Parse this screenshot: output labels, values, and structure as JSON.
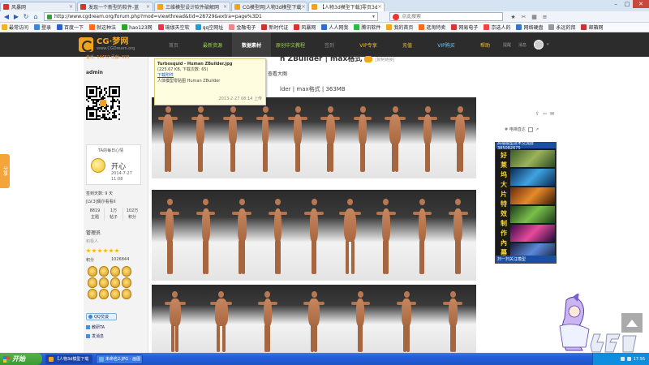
{
  "browser": {
    "tabs": [
      {
        "label": "风暴网",
        "color": "#d6332a",
        "active": false
      },
      {
        "label": "发现一个新型的软件-蓝",
        "color": "#d6332a",
        "active": false
      },
      {
        "label": "三维模型设计软件破解网",
        "color": "#f0a31c",
        "active": false
      },
      {
        "label": "CG模型网|人物3d模型下载",
        "color": "#f0a31c",
        "active": false
      },
      {
        "label": "【人物3d模型下载]零页3d",
        "color": "#f0a31c",
        "active": true
      }
    ],
    "address": "http://www.cgdream.org/forum.php?mod=viewthread&tid=28729&extra=page%3D1",
    "search_placeholder": "点此搜索"
  },
  "bookmarks": [
    {
      "label": "最常访问",
      "color": "#f0b429"
    },
    {
      "label": "登录",
      "color": "#3e87d8"
    },
    {
      "label": "百度一下",
      "color": "#2e5fd1"
    },
    {
      "label": "就这种法",
      "color": "#ff6b1a"
    },
    {
      "label": "hao123网",
      "color": "#2aa52a"
    },
    {
      "label": "瑜伽天空软",
      "color": "#e34"
    },
    {
      "label": "qq空网址",
      "color": "#1b9dd9"
    },
    {
      "label": "金融电子",
      "color": "#e88"
    },
    {
      "label": "新时代证",
      "color": "#c33"
    },
    {
      "label": "风暴网",
      "color": "#d6332a"
    },
    {
      "label": "人人网我",
      "color": "#2d6fd1"
    },
    {
      "label": "腾讯软件",
      "color": "#2db84a"
    },
    {
      "label": "我的首页",
      "color": "#f4a81c"
    },
    {
      "label": "逛淘特卖",
      "color": "#f36b1c"
    },
    {
      "label": "网易电子",
      "color": "#d33"
    },
    {
      "label": "京选人的",
      "color": "#e44"
    },
    {
      "label": "网络硬盘",
      "color": "#3377cc"
    },
    {
      "label": "永远的拜",
      "color": "#999"
    },
    {
      "label": "邮箱网",
      "color": "#c33"
    }
  ],
  "site": {
    "logo_name": "CG·梦网",
    "logo_sub": "www.CGDream.org",
    "nav": [
      {
        "label": "首页",
        "style": "dim"
      },
      {
        "label": "最新资源",
        "style": "hl"
      },
      {
        "label": "数据素材",
        "style": "cur"
      },
      {
        "label": "原创中文教程",
        "style": "hl"
      },
      {
        "label": "签到",
        "style": "dim"
      },
      {
        "label": "VIP专享",
        "style": "yl"
      },
      {
        "label": "充值",
        "style": "yl"
      },
      {
        "label": "VIP购买",
        "style": "bl"
      },
      {
        "label": "帮助",
        "style": "yl"
      }
    ],
    "user_links": [
      "提醒",
      "消息"
    ]
  },
  "sidebar": {
    "stats_line": "金币: 14452  贡献: 693",
    "username": "admin",
    "mood_label": "TA的每日心情",
    "mood": "开心",
    "mood_date": "2014-7-27 11:08",
    "signin_days": "签到天数: 9 天",
    "level": "[LV.3]偶尔看看II",
    "stats": [
      {
        "value": "8819",
        "label": "主题"
      },
      {
        "value": "1万",
        "label": "帖子"
      },
      {
        "value": "102万",
        "label": "积分"
      }
    ],
    "group": "管理员",
    "group_sub": "积极人",
    "score_label": "积分",
    "score": "1026844",
    "qq": "QQ交谈",
    "links": [
      "教研TA",
      "发消息"
    ]
  },
  "content": {
    "title": "n ZBuilder | max格式",
    "title_tag": "[复制链接]",
    "subline": "lder | max格式 | 363MB",
    "attachment": {
      "filename": "Turbosquid - Human ZBuilder.jpg",
      "size": "(225.67 KB, 下载次数: 65)",
      "download": "下载附件",
      "desc": "人体模型零贴图 Human ZBuilder",
      "time": "2013-2-27 08:14 上传",
      "enlarge": "查看大图"
    },
    "tools": "电梯直达"
  },
  "ad": {
    "top": "高端模型技术交流群 385082675",
    "bottom": "扫一扫关注模型",
    "vchars": [
      "好",
      "莱",
      "坞",
      "大",
      "片",
      "特",
      "效",
      "制",
      "作",
      "內",
      "幕"
    ]
  },
  "share_tab": "分享",
  "taskbar": {
    "start": "开始",
    "tasks": [
      {
        "label": "【人物3d模型下载",
        "color": "#f0a31c",
        "active": true
      },
      {
        "label": "未命名2.JPG - 画图",
        "color": "#68b2e8",
        "active": false
      }
    ],
    "time": "17:56"
  }
}
